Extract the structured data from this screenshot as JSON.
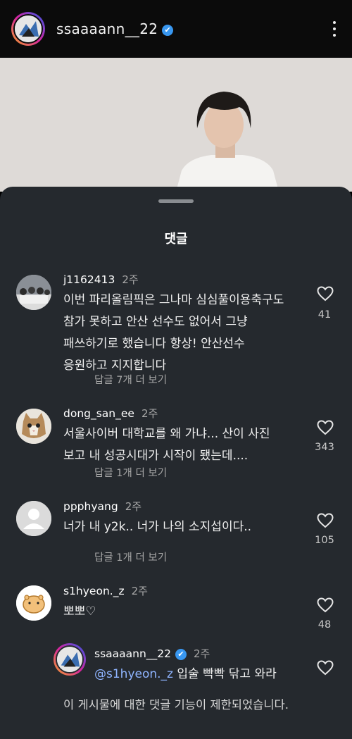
{
  "post": {
    "username": "ssaaaann__22",
    "verified_badge": "✔",
    "more_icon": "more-vertical-icon"
  },
  "sheet": {
    "title": "댓글",
    "footer_note": "이 게시물에 대한 댓글 기능이 제한되었습니다."
  },
  "comments": [
    {
      "username": "j1162413",
      "time": "2주",
      "text": "이번 파리올림픽은 그나마 심심풀이용축구도\n참가 못하고 안산 선수도 없어서 그냥\n패쓰하기로 했습니다 항상! 안산선수\n응원하고 지지합니다",
      "replies": "답글 7개 더 보기",
      "likes": "41"
    },
    {
      "username": "dong_san_ee",
      "time": "2주",
      "text": "서울사이버 대학교를 왜 가냐... 산이 사진\n보고 내 성공시대가 시작이 됐는데....",
      "replies": "답글 1개 더 보기",
      "likes": "343"
    },
    {
      "username": "ppphyang",
      "time": "2주",
      "text": "너가 내 y2k.. 너가 나의 소지섭이다..",
      "replies": "답글 1개 더 보기",
      "likes": "105"
    },
    {
      "username": "s1hyeon._z",
      "time": "2주",
      "text": "뽀뽀♡",
      "likes": "48"
    }
  ],
  "reply": {
    "username": "ssaaaann__22",
    "verified_badge": "✔",
    "time": "2주",
    "mention": "@s1hyeon._z",
    "text": " 입술 빡빡 닦고 와라"
  },
  "colors": {
    "sheet_bg": "#25292e",
    "topbar_bg": "#0b0b0b",
    "secondary_text": "#a8a8a8",
    "mention": "#8fb4ff",
    "verified": "#3897f0"
  }
}
